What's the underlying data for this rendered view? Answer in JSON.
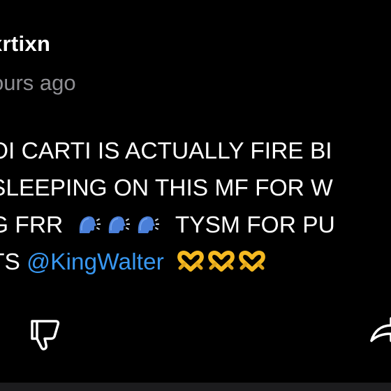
{
  "comment": {
    "username": "xrtixn",
    "timestamp": "ours ago",
    "lines": [
      "OI CARTI IS ACTUALLY FIRE BI",
      "SLEEPING ON THIS MF FOR W",
      "G FRR",
      "TYSM FOR PU",
      "TS"
    ],
    "mention": "@KingWalter"
  },
  "icons": {
    "speaking_head": "speaking-head-emoji",
    "heart_hands": "heart-hands-emoji",
    "dislike": "thumbs-down-icon",
    "share": "share-icon"
  },
  "colors": {
    "background": "#000000",
    "text": "#ffffff",
    "muted": "#8e8e93",
    "mention": "#3897f0"
  }
}
